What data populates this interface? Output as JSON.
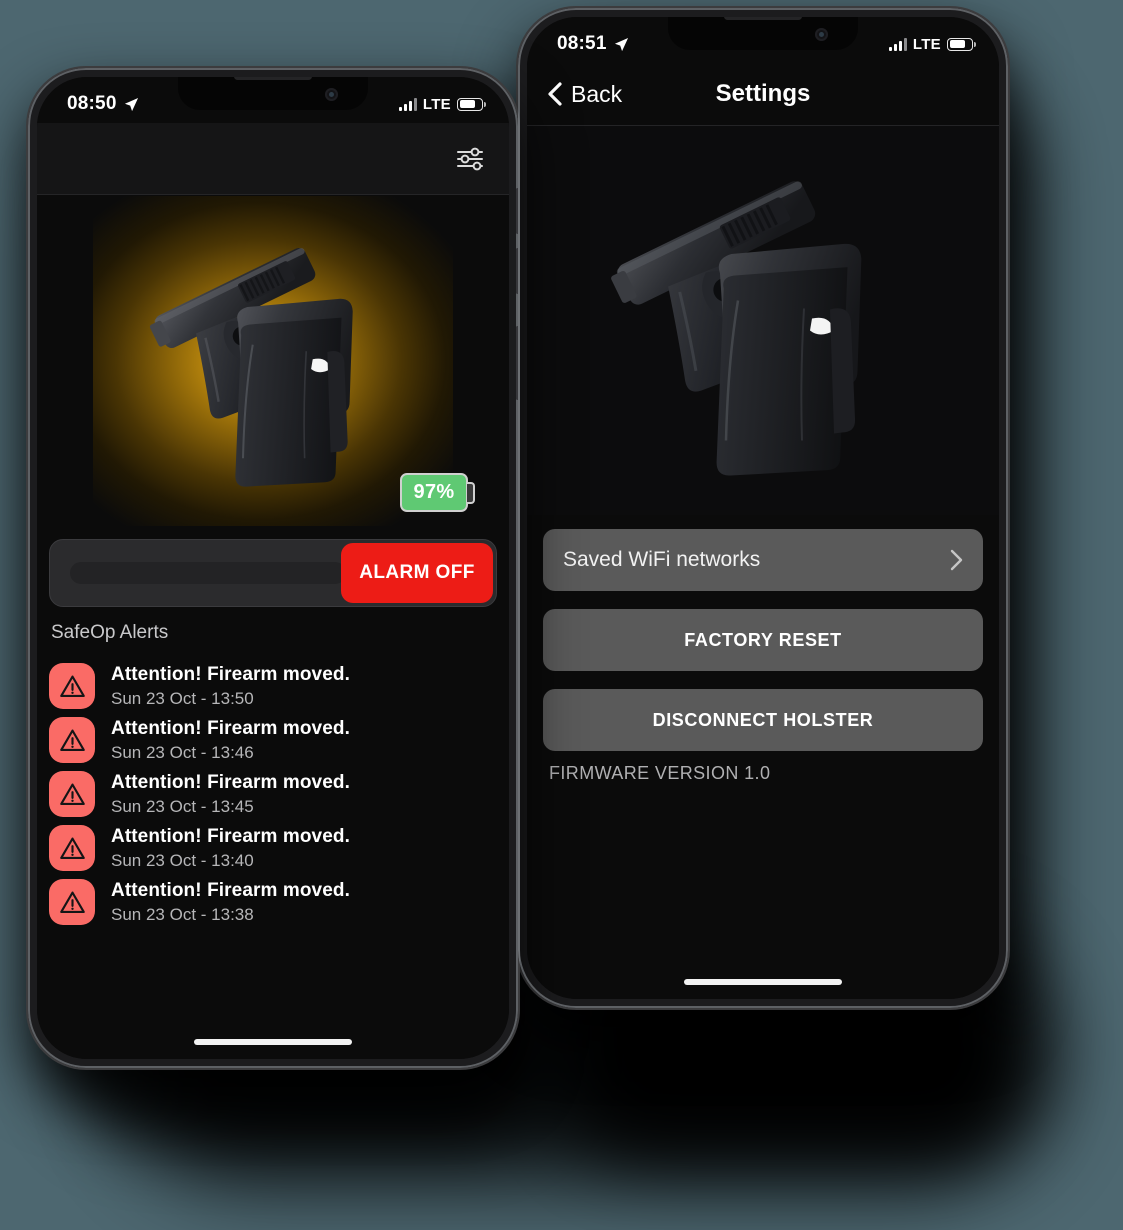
{
  "background_color": "#4d6770",
  "home_phone": {
    "status_bar": {
      "time": "08:50",
      "location_icon": "location-arrow-icon",
      "signal_icon": "cellular-bars-icon",
      "network": "LTE",
      "battery_icon": "battery-icon"
    },
    "toolbar": {
      "settings_icon": "sliders-icon"
    },
    "hero": {
      "product_image": "holster-with-firearm-image",
      "glow": "amber-radial-glow",
      "battery_badge": {
        "value": "97%",
        "color": "#5fc973"
      }
    },
    "alarm_slider": {
      "button_label": "ALARM OFF",
      "button_color": "#ed1c16",
      "track_hint": ""
    },
    "alerts": {
      "section_title": "SafeOp Alerts",
      "items": [
        {
          "icon": "warning-triangle-icon",
          "title": "Attention! Firearm moved.",
          "timestamp": "Sun 23 Oct - 13:50"
        },
        {
          "icon": "warning-triangle-icon",
          "title": "Attention! Firearm moved.",
          "timestamp": "Sun 23 Oct - 13:46"
        },
        {
          "icon": "warning-triangle-icon",
          "title": "Attention! Firearm moved.",
          "timestamp": "Sun 23 Oct - 13:45"
        },
        {
          "icon": "warning-triangle-icon",
          "title": "Attention! Firearm moved.",
          "timestamp": "Sun 23 Oct - 13:40"
        },
        {
          "icon": "warning-triangle-icon",
          "title": "Attention! Firearm moved.",
          "timestamp": "Sun 23 Oct - 13:38"
        }
      ]
    }
  },
  "settings_phone": {
    "status_bar": {
      "time": "08:51",
      "location_icon": "location-arrow-icon",
      "signal_icon": "cellular-bars-icon",
      "network": "LTE",
      "battery_icon": "battery-icon"
    },
    "nav": {
      "back_label": "Back",
      "back_icon": "chevron-left-icon",
      "title": "Settings"
    },
    "hero": {
      "product_image": "holster-with-firearm-image"
    },
    "items": [
      {
        "label": "Saved WiFi networks",
        "type": "link",
        "accessory_icon": "chevron-right-icon"
      },
      {
        "label": "FACTORY RESET",
        "type": "action"
      },
      {
        "label": "DISCONNECT HOLSTER",
        "type": "action"
      }
    ],
    "firmware_version": "FIRMWARE VERSION 1.0"
  }
}
